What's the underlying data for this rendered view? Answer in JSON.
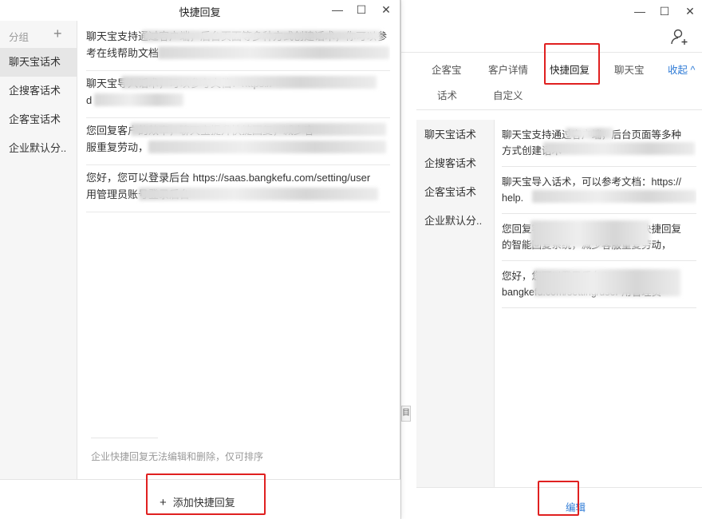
{
  "front": {
    "title": "快捷回复",
    "sidebar": {
      "header": "分组",
      "items": [
        "聊天宝话术",
        "企搜客话术",
        "企客宝话术",
        "企业默认分.."
      ]
    },
    "replies": [
      {
        "l1": "聊天宝支持通过客户端，后台页面等多种方式创建话术，你可以参",
        "l2": "考在线帮助文档"
      },
      {
        "l1": "聊天宝导入话术，可以参考文档：https://",
        "l2": "d"
      },
      {
        "l1": "您回复客户的效率，聊天宝提升快捷回复，减少客",
        "l2": "服重复劳动，"
      },
      {
        "l1": "您好，您可以登录后台 https://saas.bangkefu.com/setting/user",
        "l2": "用管理员账号登录后台"
      }
    ],
    "note": "企业快捷回复无法编辑和删除，仅可排序",
    "add_button": "添加快捷回复"
  },
  "back": {
    "tabs": [
      "企客宝",
      "客户详情",
      "快捷回复",
      "聊天宝",
      "收起"
    ],
    "subtabs": [
      "话术",
      "自定义"
    ],
    "sidebar_items": [
      "聊天宝话术",
      "企搜客话术",
      "企客宝话术",
      "企业默认分.."
    ],
    "replies": [
      {
        "l1": "聊天宝支持通过客户端，后台页面等多种",
        "l2": "方式创建话术"
      },
      {
        "l1": "聊天宝导入话术，可以参考文档：https://",
        "l2": "help."
      },
      {
        "l1": "您回复客户的效率，聊天宝提升快捷回复",
        "l2": "的智能回复系统，减少客服重复劳动，"
      },
      {
        "l1": "您好，您可以登录后台 https://saas.",
        "l2": "bangkefu.com/setting/user 用管理员"
      }
    ],
    "edit_button": "编辑"
  },
  "colors": {
    "accent": "#2f7bd6",
    "highlight": "#e02020"
  }
}
